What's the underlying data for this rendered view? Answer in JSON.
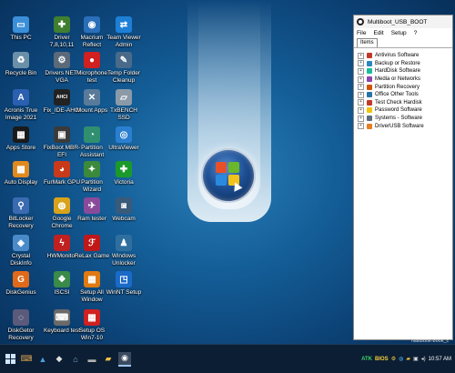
{
  "desktop": {
    "icons": [
      {
        "label": "This PC",
        "icon": "computer-icon",
        "color": "#3b8fd9",
        "glyph": "▭"
      },
      {
        "label": "Driver 7,8,10,11",
        "icon": "driver-icon",
        "color": "#3f7f2f",
        "glyph": "✚"
      },
      {
        "label": "Macrium Reflect",
        "icon": "macrium-icon",
        "color": "#2a6fb8",
        "glyph": "◉"
      },
      {
        "label": "Team Viewer Admin",
        "icon": "teamviewer-icon",
        "color": "#1e7fd6",
        "glyph": "⇄"
      },
      {
        "label": "Recycle Bin",
        "icon": "recycle-bin-icon",
        "color": "#6a8fa8",
        "glyph": "♻"
      },
      {
        "label": "Drivers NET-VGA",
        "icon": "drivers-net-icon",
        "color": "#5a6a7a",
        "glyph": "⚙"
      },
      {
        "label": "Microphone test",
        "icon": "microphone-icon",
        "color": "#d02020",
        "glyph": "●"
      },
      {
        "label": "Temp Folder Cleanup",
        "icon": "cleanup-icon",
        "color": "#4a6a8a",
        "glyph": "✎"
      },
      {
        "label": "Acronis True Image 2021",
        "icon": "acronis-icon",
        "color": "#2b5fb0",
        "glyph": "A"
      },
      {
        "label": "Fix_IDE-AHCI",
        "icon": "ahci-icon",
        "color": "#222222",
        "glyph": "AHCI"
      },
      {
        "label": "Mount Apps",
        "icon": "mount-apps-icon",
        "color": "#5a7a99",
        "glyph": "✕"
      },
      {
        "label": "TxBENCH SSD",
        "icon": "txbench-icon",
        "color": "#8a9aa8",
        "glyph": "▱"
      },
      {
        "label": "Apps Store",
        "icon": "apps-store-icon",
        "color": "#1a1a1a",
        "glyph": "▦"
      },
      {
        "label": "FixBoot MBR-EFI",
        "icon": "fixboot-icon",
        "color": "#3a3a3a",
        "glyph": "▣"
      },
      {
        "label": "Partition Assistant",
        "icon": "partition-assistant-icon",
        "color": "#2f8f6f",
        "glyph": "◔"
      },
      {
        "label": "UltraViewer",
        "icon": "ultraviewer-icon",
        "color": "#2a7fd0",
        "glyph": "◎"
      },
      {
        "label": "Auto Display",
        "icon": "auto-display-icon",
        "color": "#e08a1e",
        "glyph": "▩"
      },
      {
        "label": "FurMark GPU",
        "icon": "furmark-icon",
        "color": "#c83a1a",
        "glyph": "◕"
      },
      {
        "label": "Partition Wizard",
        "icon": "partition-wizard-icon",
        "color": "#3b8a3b",
        "glyph": "✦"
      },
      {
        "label": "Victoria",
        "icon": "victoria-icon",
        "color": "#1a9a2a",
        "glyph": "✚"
      },
      {
        "label": "BitLocker Recovery",
        "icon": "bitlocker-icon",
        "color": "#3a6ab0",
        "glyph": "⚲"
      },
      {
        "label": "Google Chrome",
        "icon": "chrome-icon",
        "color": "#d8a31a",
        "glyph": "◍"
      },
      {
        "label": "Ram tester",
        "icon": "ram-tester-icon",
        "color": "#8a4a9a",
        "glyph": "✈"
      },
      {
        "label": "Webcam",
        "icon": "webcam-icon",
        "color": "#3a5a7a",
        "glyph": "◙"
      },
      {
        "label": "Crystal DiskInfo",
        "icon": "crystal-diskinfo-icon",
        "color": "#4a8ac8",
        "glyph": "◈"
      },
      {
        "label": "HWMonitor",
        "icon": "hwmonitor-icon",
        "color": "#c02020",
        "glyph": "ϟ"
      },
      {
        "label": "ReLax Game",
        "icon": "relax-game-icon",
        "color": "#c01818",
        "glyph": "ℱ"
      },
      {
        "label": "Windows Unlocker",
        "icon": "windows-unlocker-icon",
        "color": "#2f6f9f",
        "glyph": "♟"
      },
      {
        "label": "DiskGenius",
        "icon": "diskgenius-icon",
        "color": "#e06a1a",
        "glyph": "G"
      },
      {
        "label": "ISCSI",
        "icon": "iscsi-icon",
        "color": "#3a8a4a",
        "glyph": "❖"
      },
      {
        "label": "Setup All Window",
        "icon": "setup-all-icon",
        "color": "#e07a10",
        "glyph": "▦"
      },
      {
        "label": "WinNT Setup",
        "icon": "winnt-setup-icon",
        "color": "#1a6ac8",
        "glyph": "◳"
      },
      {
        "label": "DiskGetor Recovery",
        "icon": "diskgetor-icon",
        "color": "#5a5a7a",
        "glyph": "◌"
      },
      {
        "label": "Keyboard test",
        "icon": "keyboard-icon",
        "color": "#6a6a6a",
        "glyph": "⌨"
      },
      {
        "label": "Setup OS Win7-10",
        "icon": "setup-os-icon",
        "color": "#d02020",
        "glyph": "▦"
      }
    ]
  },
  "panel": {
    "title": "Multiboot_USB_BOOT",
    "menu": [
      "File",
      "Edit",
      "Setup",
      "?"
    ],
    "tab": "Items",
    "items": [
      {
        "label": "Antivirus Software",
        "color": "#c0392b"
      },
      {
        "label": "Backup or Restore",
        "color": "#2e86c1"
      },
      {
        "label": "HardDisk Software",
        "color": "#1abc9c"
      },
      {
        "label": "Media or Networks",
        "color": "#8e44ad"
      },
      {
        "label": "Partition Recovery",
        "color": "#d35400"
      },
      {
        "label": "Office Other Tools",
        "color": "#2874a6"
      },
      {
        "label": "Test Check Hardisk",
        "color": "#c0392b"
      },
      {
        "label": "Password Software",
        "color": "#f1c40f"
      },
      {
        "label": "Systems - Software",
        "color": "#5d6d7e"
      },
      {
        "label": "DriverUSB Software",
        "color": "#e67e22"
      }
    ]
  },
  "watermark": "Nasbook-book_c",
  "taskbar": {
    "tray_text_1": "ATK",
    "tray_text_2": "BIOS",
    "clock": "10:57 AM",
    "colors": {
      "tray_green": "#3ad16a",
      "tray_yellow": "#f5d03a"
    }
  }
}
